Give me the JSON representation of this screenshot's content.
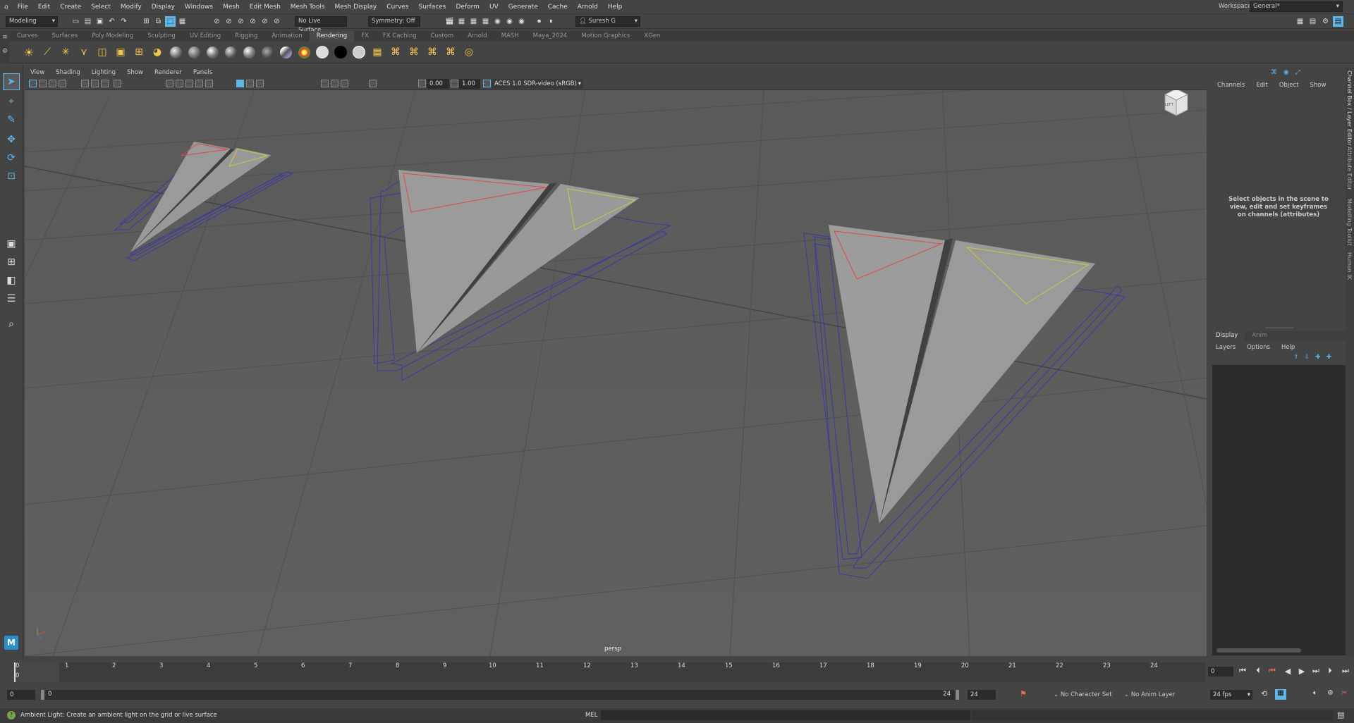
{
  "menubar": {
    "items": [
      "File",
      "Edit",
      "Create",
      "Select",
      "Modify",
      "Display",
      "Windows",
      "Mesh",
      "Edit Mesh",
      "Mesh Tools",
      "Mesh Display",
      "Curves",
      "Surfaces",
      "Deform",
      "UV",
      "Generate",
      "Cache",
      "Arnold",
      "Help"
    ],
    "workspace_label": "Workspace:",
    "workspace_value": "General*"
  },
  "statusline": {
    "mode": "Modeling",
    "live_surface": "No Live Surface",
    "symmetry": "Symmetry: Off",
    "user": "Suresh G"
  },
  "shelf": {
    "tabs": [
      "Curves",
      "Surfaces",
      "Poly Modeling",
      "Sculpting",
      "UV Editing",
      "Rigging",
      "Animation",
      "Rendering",
      "FX",
      "FX Caching",
      "Custom",
      "Arnold",
      "MASH",
      "Maya_2024",
      "Motion Graphics",
      "XGen"
    ],
    "active_tab": "Rendering"
  },
  "viewport": {
    "menus": [
      "View",
      "Shading",
      "Lighting",
      "Show",
      "Renderer",
      "Panels"
    ],
    "exposure": "0.00",
    "gamma": "1.00",
    "color_space": "ACES 1.0 SDR-video (sRGB)",
    "camera_label": "persp",
    "viewcube_label": "LEFT"
  },
  "channel_box": {
    "menus": [
      "Channels",
      "Edit",
      "Object",
      "Show"
    ],
    "empty_message": "Select objects in the scene to view, edit and set keyframes on channels (attributes)"
  },
  "layer_editor": {
    "tabs": [
      "Display",
      "Anim"
    ],
    "menus": [
      "Layers",
      "Options",
      "Help"
    ]
  },
  "right_side_tabs": [
    "Channel Box / Layer Editor",
    "Attribute Editor",
    "Modelling Toolkit",
    "Human IK"
  ],
  "timeline": {
    "ticks": [
      "1",
      "2",
      "3",
      "4",
      "5",
      "6",
      "7",
      "8",
      "9",
      "10",
      "11",
      "12",
      "13",
      "14",
      "15",
      "16",
      "17",
      "18",
      "19",
      "20",
      "21",
      "22",
      "23",
      "24"
    ],
    "current_frame": "0",
    "marker_value": "0",
    "frame_field": "0"
  },
  "range": {
    "start": "0",
    "range_start": "0",
    "range_end": "24",
    "end": "24",
    "character_set": "No Character Set",
    "anim_layer": "No Anim Layer",
    "fps": "24 fps"
  },
  "helpline": {
    "text": "Ambient Light: Create an ambient light on the grid or live surface",
    "mel_label": "MEL"
  },
  "colors": {
    "viewport_bg": "#5d5d5d",
    "selection_blue": "#3a3aa0",
    "active_highlight": "#5fb4e8"
  }
}
